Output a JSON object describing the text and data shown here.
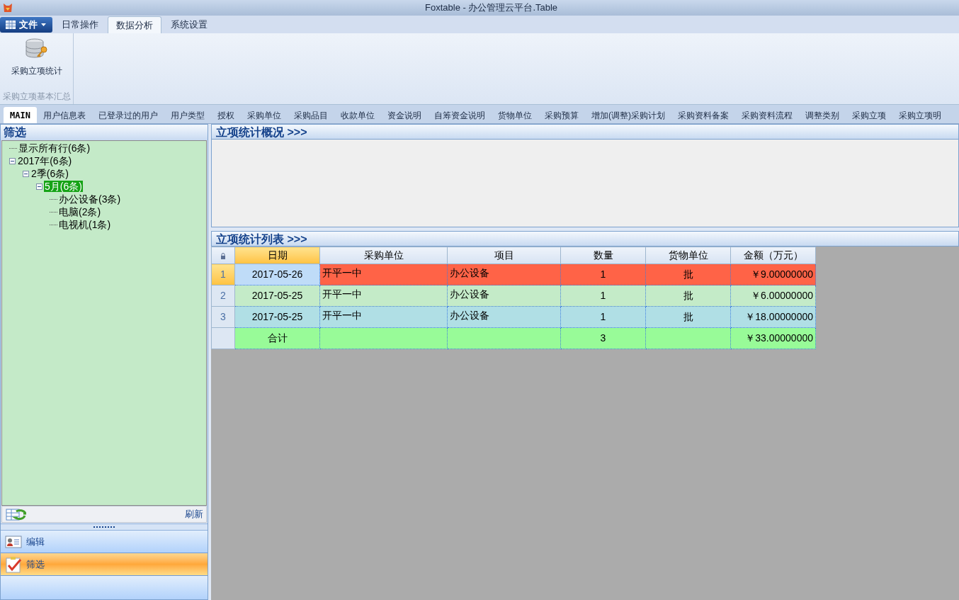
{
  "window": {
    "title": "Foxtable - 办公管理云平台.Table"
  },
  "menu_tabs": [
    {
      "label": "文件",
      "kind": "file",
      "selected": false
    },
    {
      "label": "日常操作",
      "kind": "tab",
      "selected": false
    },
    {
      "label": "数据分析",
      "kind": "tab",
      "selected": true
    },
    {
      "label": "系统设置",
      "kind": "tab",
      "selected": false
    }
  ],
  "ribbon": {
    "groups": [
      {
        "label": "采购立项基本汇总",
        "buttons": [
          "采购立项统计"
        ]
      }
    ]
  },
  "table_tabs": [
    {
      "label": "MAIN",
      "selected": true
    },
    {
      "label": "用户信息表",
      "selected": false
    },
    {
      "label": "已登录过的用户",
      "selected": false
    },
    {
      "label": "用户类型",
      "selected": false
    },
    {
      "label": "授权",
      "selected": false
    },
    {
      "label": "采购单位",
      "selected": false
    },
    {
      "label": "采购品目",
      "selected": false
    },
    {
      "label": "收款单位",
      "selected": false
    },
    {
      "label": "资金说明",
      "selected": false
    },
    {
      "label": "自筹资金说明",
      "selected": false
    },
    {
      "label": "货物单位",
      "selected": false
    },
    {
      "label": "采购预算",
      "selected": false
    },
    {
      "label": "增加(调整)采购计划",
      "selected": false
    },
    {
      "label": "采购资料备案",
      "selected": false
    },
    {
      "label": "采购资料流程",
      "selected": false
    },
    {
      "label": "调整类别",
      "selected": false
    },
    {
      "label": "采购立项",
      "selected": false
    },
    {
      "label": "采购立项明",
      "selected": false
    }
  ],
  "sidebar": {
    "title": "筛选",
    "tree": [
      {
        "label": "显示所有行(6条)",
        "selected": false
      },
      {
        "label": "2017年(6条)",
        "selected": false,
        "expanded": true,
        "children": [
          {
            "label": "2季(6条)",
            "selected": false,
            "expanded": true,
            "children": [
              {
                "label": "5月(6条)",
                "selected": true,
                "expanded": true,
                "children": [
                  {
                    "label": "办公设备(3条)",
                    "selected": false
                  },
                  {
                    "label": "电脑(2条)",
                    "selected": false
                  },
                  {
                    "label": "电视机(1条)",
                    "selected": false
                  }
                ]
              }
            ]
          }
        ]
      }
    ],
    "refresh_label": "刷新",
    "nav": [
      {
        "label": "编辑",
        "kind": "card",
        "selected": false
      },
      {
        "label": "筛选",
        "kind": "check",
        "selected": true
      }
    ]
  },
  "overview": {
    "title": "立项统计概况 >>>"
  },
  "list": {
    "title": "立项统计列表 >>>",
    "columns": [
      "日期",
      "采购单位",
      "项目",
      "数量",
      "货物单位",
      "金额（万元）"
    ],
    "rows": [
      {
        "number": "1",
        "selected": true,
        "color": "#ff6347",
        "cells": [
          "2017-05-26",
          "开平一中",
          "办公设备",
          "1",
          "批",
          "￥9.00000000"
        ]
      },
      {
        "number": "2",
        "selected": false,
        "color": "#c4ebc8",
        "cells": [
          "2017-05-25",
          "开平一中",
          "办公设备",
          "1",
          "批",
          "￥6.00000000"
        ]
      },
      {
        "number": "3",
        "selected": false,
        "color": "#b0dfe5",
        "cells": [
          "2017-05-25",
          "开平一中",
          "办公设备",
          "1",
          "批",
          "￥18.00000000"
        ]
      }
    ],
    "total": {
      "color": "#98fb98",
      "cells": [
        "合计",
        "",
        "",
        "3",
        "",
        "￥33.00000000"
      ]
    }
  }
}
